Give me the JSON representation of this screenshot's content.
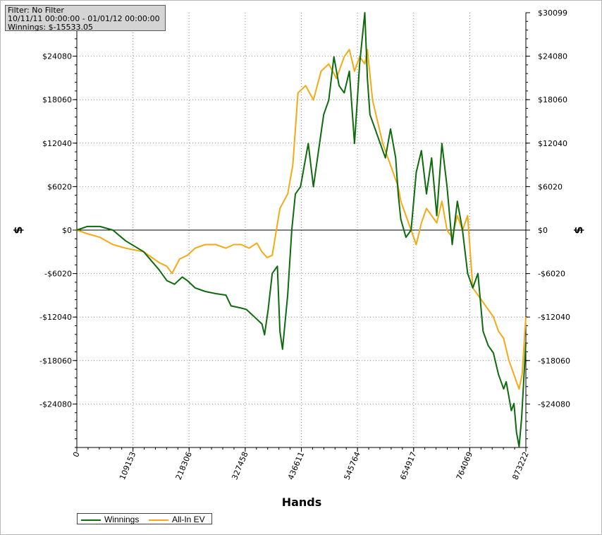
{
  "info": {
    "filter": "Filter: No Filter",
    "date_range": "10/11/11 00:00:00 - 01/01/12 00:00:00",
    "winnings": "Winnings: $-15533.05"
  },
  "axis_symbol_left": "$",
  "axis_symbol_right": "$",
  "colors": {
    "winnings": "#0d6b0d",
    "all_in_ev": "#f5a915"
  },
  "chart_data": {
    "type": "line",
    "xlabel": "Hands",
    "ylabel": "$",
    "xlim": [
      0,
      873222
    ],
    "ylim": [
      -30099,
      30099
    ],
    "x_ticks": [
      0,
      109153,
      218306,
      327458,
      436611,
      545764,
      654917,
      764069,
      873222
    ],
    "y_ticks": [
      -24080,
      -18060,
      -12040,
      -6020,
      0,
      6020,
      12040,
      18060,
      24080,
      30099
    ],
    "y_tick_labels": [
      "-$24080",
      "-$18060",
      "-$12040",
      "-$6020",
      "$0",
      "$6020",
      "$12040",
      "$18060",
      "$24080",
      "$30099"
    ],
    "grid": true,
    "legend_position": "bottom-left",
    "series": [
      {
        "name": "Winnings",
        "color": "#0d6b0d",
        "x": [
          0,
          20000,
          45000,
          70000,
          95000,
          130000,
          160000,
          175000,
          190000,
          205000,
          215000,
          230000,
          250000,
          270000,
          290000,
          300000,
          320000,
          330000,
          345000,
          360000,
          365000,
          372000,
          380000,
          390000,
          395000,
          400000,
          410000,
          418000,
          425000,
          435000,
          445000,
          450000,
          460000,
          470000,
          480000,
          490000,
          500000,
          510000,
          520000,
          530000,
          540000,
          550000,
          560000,
          565000,
          570000,
          580000,
          590000,
          600000,
          610000,
          620000,
          625000,
          630000,
          640000,
          650000,
          660000,
          670000,
          680000,
          690000,
          700000,
          710000,
          720000,
          730000,
          740000,
          750000,
          760000,
          770000,
          780000,
          790000,
          800000,
          810000,
          820000,
          830000,
          835000,
          840000,
          845000,
          850000,
          855000,
          860000,
          865000,
          873222
        ],
        "y": [
          0,
          500,
          500,
          0,
          -1500,
          -3000,
          -5500,
          -7000,
          -7500,
          -6500,
          -7000,
          -8000,
          -8500,
          -8800,
          -9000,
          -10500,
          -10800,
          -11000,
          -12000,
          -13000,
          -14500,
          -11000,
          -6000,
          -5000,
          -14000,
          -16500,
          -9000,
          0,
          5000,
          6000,
          10000,
          12000,
          6000,
          11000,
          16000,
          18000,
          24000,
          20000,
          19000,
          22000,
          12000,
          23000,
          30099,
          21000,
          16000,
          14000,
          12000,
          10000,
          14000,
          10000,
          5000,
          1500,
          -1000,
          0,
          8000,
          11000,
          5000,
          10000,
          2000,
          12000,
          6000,
          -2000,
          4000,
          0,
          -6000,
          -8000,
          -6000,
          -14000,
          -16000,
          -17000,
          -20000,
          -22000,
          -21000,
          -23000,
          -25000,
          -24000,
          -28000,
          -30000,
          -26000,
          -15533
        ]
      },
      {
        "name": "All-In EV",
        "color": "#f5a915",
        "x": [
          0,
          20000,
          45000,
          70000,
          95000,
          130000,
          160000,
          175000,
          185000,
          200000,
          215000,
          230000,
          250000,
          270000,
          290000,
          305000,
          320000,
          335000,
          350000,
          360000,
          370000,
          380000,
          395000,
          410000,
          420000,
          430000,
          445000,
          460000,
          475000,
          490000,
          505000,
          520000,
          530000,
          540000,
          550000,
          560000,
          565000,
          575000,
          585000,
          595000,
          605000,
          615000,
          625000,
          630000,
          640000,
          650000,
          660000,
          670000,
          680000,
          690000,
          700000,
          710000,
          720000,
          730000,
          740000,
          750000,
          760000,
          770000,
          780000,
          790000,
          800000,
          810000,
          820000,
          830000,
          840000,
          850000,
          855000,
          860000,
          866000,
          873222
        ],
        "y": [
          0,
          -500,
          -1000,
          -2000,
          -2500,
          -3000,
          -4500,
          -5000,
          -6000,
          -4000,
          -3500,
          -2500,
          -2000,
          -2000,
          -2500,
          -2000,
          -2000,
          -2500,
          -1800,
          -3000,
          -3800,
          -3500,
          3000,
          5000,
          9000,
          19000,
          20000,
          18000,
          22000,
          23000,
          21000,
          24000,
          25000,
          22000,
          24000,
          23000,
          25000,
          18000,
          15000,
          12000,
          10000,
          8000,
          6000,
          4000,
          2000,
          0,
          -2000,
          1000,
          3000,
          2000,
          1000,
          4000,
          0,
          -1000,
          2000,
          0,
          2000,
          -8000,
          -9000,
          -10000,
          -11000,
          -12000,
          -14000,
          -15000,
          -18000,
          -20000,
          -21000,
          -22000,
          -20000,
          -12040
        ]
      }
    ]
  }
}
